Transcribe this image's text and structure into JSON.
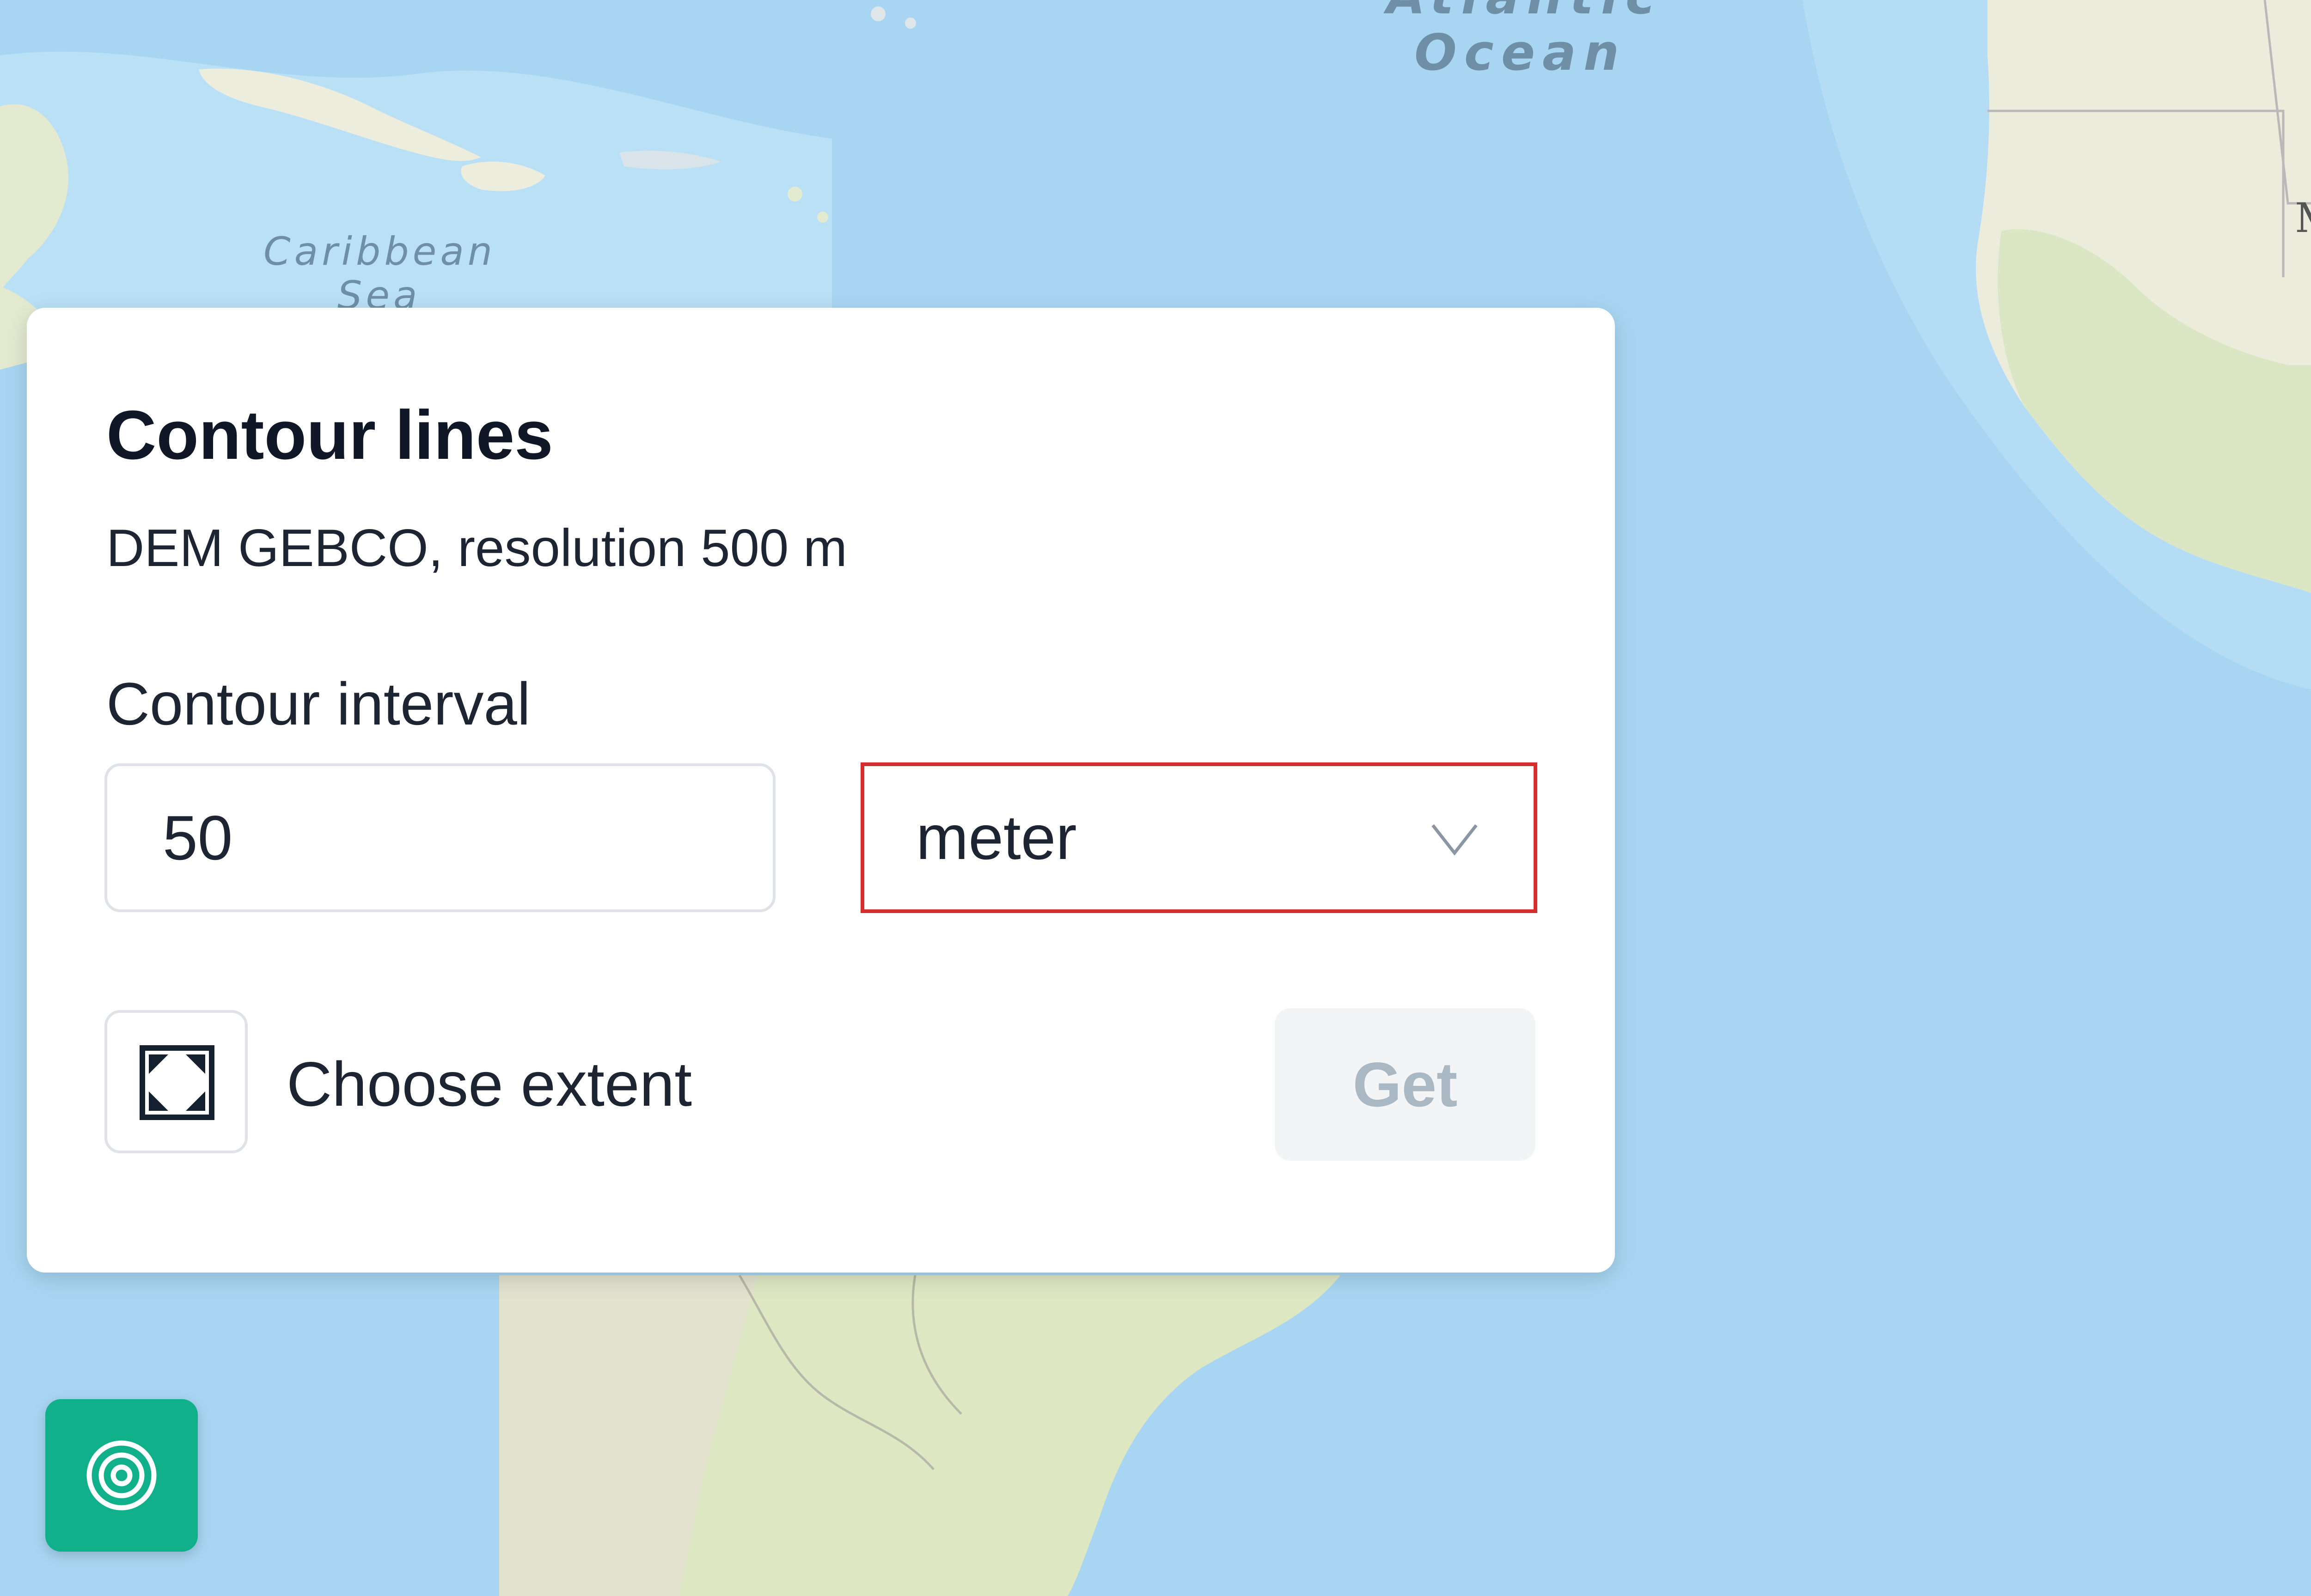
{
  "map": {
    "labels": {
      "ocean_partial": "Atlantic",
      "ocean": "Ocean",
      "caribbean_line1": "Caribbean",
      "caribbean_line2": "Sea",
      "edge_letter": "M"
    },
    "colors": {
      "water": "#a8d6f2",
      "land": "#e6ecd4"
    }
  },
  "panel": {
    "title": "Contour lines",
    "subtitle": "DEM GEBCO, resolution 500 m",
    "interval_label": "Contour interval",
    "interval_value": "50",
    "unit_selected": "meter",
    "extent_label": "Choose extent",
    "extent_icon": "select-extent-icon",
    "get_label": "Get",
    "get_enabled": false,
    "highlight_color": "#d32f2f"
  },
  "fab": {
    "icon": "contour-layers-icon",
    "color": "#0fb08a"
  }
}
